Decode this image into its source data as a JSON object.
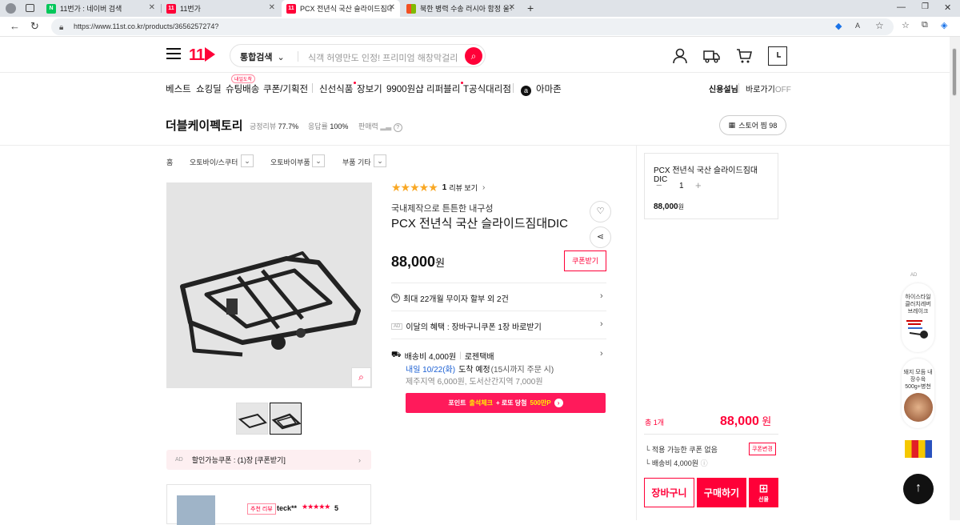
{
  "browser": {
    "tabs": [
      {
        "title": "11번가 : 네이버 검색",
        "fav_color": "#03c75a",
        "fav_text": "N"
      },
      {
        "title": "11번가",
        "fav_color": "#ff0038",
        "fav_text": "11"
      },
      {
        "title": "PCX 전년식 국산 슬라이드짐대DIC",
        "fav_color": "#ff0038",
        "fav_text": "11"
      },
      {
        "title": "북한 병력 수송 러시아 함정 울직",
        "fav_color": "#f25022",
        "fav_text": ""
      }
    ],
    "url": "https://www.11st.co.kr/products/3656257274?"
  },
  "header": {
    "logo": "11",
    "search_category": "통합검색",
    "search_placeholder": "식객 허영만도 인정! 프리미엄 해창막걸리",
    "icons": [
      "user-icon",
      "truck-icon",
      "cart-icon",
      "recent-icon"
    ]
  },
  "gnb": {
    "items": [
      "베스트",
      "쇼킹딜",
      "슈팅배송",
      "쿠폰/기획전",
      "신선식품",
      "장보기",
      "9900원샵",
      "리퍼블리",
      "T공식대리점",
      "아마존"
    ],
    "badge": "내일도착",
    "right1": "신용설님",
    "right2": "바로가기",
    "right2_suffix": "OFF"
  },
  "seller": {
    "name": "더블케이펙토리",
    "review_label": "긍정리뷰",
    "review_value": "77.7%",
    "reply_label": "응답률",
    "reply_value": "100%",
    "sales_label": "판매력",
    "store_btn": "스토어 찜 98"
  },
  "breadcrumb": [
    "홈",
    "오토바이/스쿠터",
    "오토바이부품",
    "부품 기타"
  ],
  "product": {
    "stars": "★★★★★",
    "review_count": "1",
    "review_link": "리뷰 보기",
    "subtitle": "국내제작으로 튼튼한 내구성",
    "title": "PCX 전년식 국산 슬라이드짐대DIC",
    "price": "88,000",
    "won": "원",
    "coupon_btn": "쿠폰받기",
    "installment": "최대 22개월 무이자 할부 외 2건",
    "benefit_ad": "AD",
    "benefit": "이달의 혜택 : 장바구니쿠폰 1장 바로받기",
    "shipping": "배송비 4,000원",
    "shipping_co": "로젠택배",
    "delivery_date": "내일 10/22(화)",
    "delivery_rest": "도착 예정",
    "delivery_note": "(15시까지 주문 시)",
    "extra_fee": "제주지역 6,000원, 도서산간지역 7,000원",
    "point_prefix": "포인트",
    "point_hl": "출석체크",
    "point_mid": "+ 로또 당첨",
    "point_amount": "500만P"
  },
  "left_bottom": {
    "ad": "AD",
    "coupon_text": "할인가능쿠폰 : (1)장 [쿠폰받기]",
    "rev_tag": "추천 리뷰",
    "rev_user": "teck**",
    "rev_stars": "★★★★★",
    "rev_score": "5"
  },
  "order": {
    "option_title": "PCX 전년식 국산 슬라이드짐대DIC",
    "qty": "1",
    "option_price": "88,000",
    "option_won": "원",
    "total_label": "총 1개",
    "total_price": "88,000",
    "total_won": "원",
    "coupon_none": "적용 가능한 쿠폰 없음",
    "coupon_change": "쿠폰변경",
    "ship_fee": "배송비 4,000원",
    "cart_btn": "장바구니",
    "buy_btn": "구매하기",
    "gift_btn": "선물"
  },
  "side_ads": {
    "ad_label": "AD",
    "ad1": "하이스타일 클러치레버 브레이크",
    "ad2": "돼지 모듬 내장수육 500g+병천",
    "top_btn": "↑"
  },
  "colors": {
    "brand": "#ff0038",
    "point": "#ff1a5b",
    "blue": "#1a5fd3"
  }
}
